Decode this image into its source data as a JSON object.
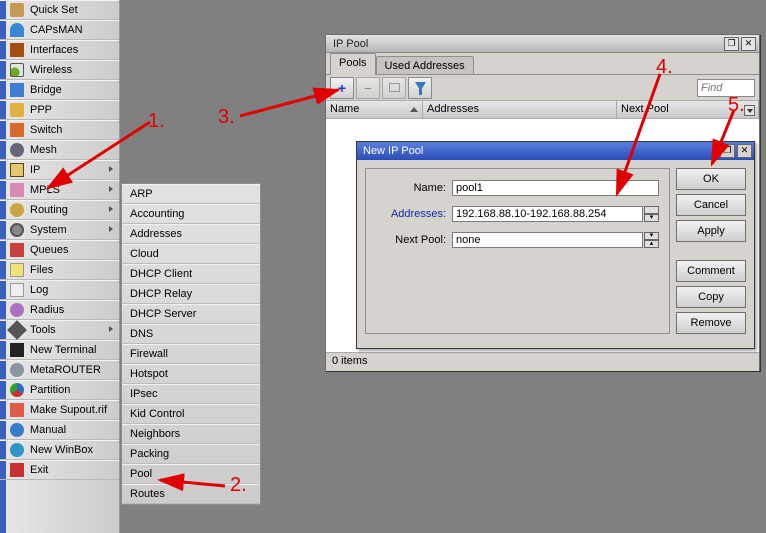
{
  "menu": {
    "items": [
      {
        "label": "Quick Set",
        "icon": "quick",
        "sub": false
      },
      {
        "label": "CAPsMAN",
        "icon": "caps",
        "sub": false
      },
      {
        "label": "Interfaces",
        "icon": "if",
        "sub": false
      },
      {
        "label": "Wireless",
        "icon": "wifi",
        "sub": false
      },
      {
        "label": "Bridge",
        "icon": "bridge",
        "sub": false
      },
      {
        "label": "PPP",
        "icon": "ppp",
        "sub": false
      },
      {
        "label": "Switch",
        "icon": "switch",
        "sub": false
      },
      {
        "label": "Mesh",
        "icon": "mesh",
        "sub": false
      },
      {
        "label": "IP",
        "icon": "ip",
        "sub": true
      },
      {
        "label": "MPLS",
        "icon": "mpls",
        "sub": true
      },
      {
        "label": "Routing",
        "icon": "rout",
        "sub": true
      },
      {
        "label": "System",
        "icon": "sys",
        "sub": true
      },
      {
        "label": "Queues",
        "icon": "queue",
        "sub": false
      },
      {
        "label": "Files",
        "icon": "files",
        "sub": false
      },
      {
        "label": "Log",
        "icon": "log",
        "sub": false
      },
      {
        "label": "Radius",
        "icon": "radius",
        "sub": false
      },
      {
        "label": "Tools",
        "icon": "tools",
        "sub": true
      },
      {
        "label": "New Terminal",
        "icon": "term",
        "sub": false
      },
      {
        "label": "MetaROUTER",
        "icon": "meta",
        "sub": false
      },
      {
        "label": "Partition",
        "icon": "part",
        "sub": false
      },
      {
        "label": "Make Supout.rif",
        "icon": "supout",
        "sub": false
      },
      {
        "label": "Manual",
        "icon": "man",
        "sub": false
      },
      {
        "label": "New WinBox",
        "icon": "winbx",
        "sub": false
      },
      {
        "label": "Exit",
        "icon": "exit",
        "sub": false
      }
    ]
  },
  "submenu": {
    "items": [
      "ARP",
      "Accounting",
      "Addresses",
      "Cloud",
      "DHCP Client",
      "DHCP Relay",
      "DHCP Server",
      "DNS",
      "Firewall",
      "Hotspot",
      "IPsec",
      "Kid Control",
      "Neighbors",
      "Packing",
      "Pool",
      "Routes"
    ]
  },
  "pool_win": {
    "title": "IP Pool",
    "tabs": {
      "active": "Pools",
      "other": "Used Addresses"
    },
    "find_placeholder": "Find",
    "cols": {
      "name": "Name",
      "addr": "Addresses",
      "next": "Next Pool"
    },
    "status": "0 items"
  },
  "dlg": {
    "title": "New IP Pool",
    "labels": {
      "name": "Name:",
      "addr": "Addresses:",
      "next": "Next Pool:"
    },
    "values": {
      "name": "pool1",
      "addr": "192.168.88.10-192.168.88.254",
      "next": "none"
    },
    "buttons": {
      "ok": "OK",
      "cancel": "Cancel",
      "apply": "Apply",
      "comment": "Comment",
      "copy": "Copy",
      "remove": "Remove"
    }
  },
  "ann": {
    "a1": "1.",
    "a2": "2.",
    "a3": "3.",
    "a4": "4.",
    "a5": "5."
  }
}
